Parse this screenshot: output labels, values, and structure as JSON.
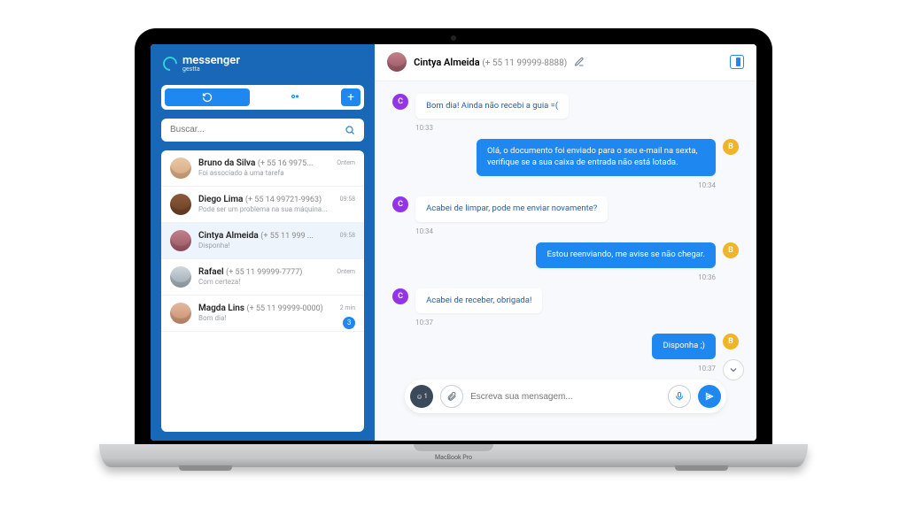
{
  "brand": {
    "name": "messenger",
    "sub": "gestta"
  },
  "search": {
    "placeholder": "Buscar..."
  },
  "segmented": {
    "add_label": "+"
  },
  "conversations": [
    {
      "name": "Bruno da Silva",
      "phone": "(+ 55 16 9975...",
      "preview": "Foi associado à uma tarefa",
      "time": "Ontem"
    },
    {
      "name": "Diego Lima",
      "phone": "(+ 55 14 99721-9963)",
      "preview": "Pode ser um problema na sua máquina...",
      "time": "09:58"
    },
    {
      "name": "Cintya Almeida",
      "phone": "(+ 55 11 999 ...",
      "preview": "Disponha!",
      "time": "09:58"
    },
    {
      "name": "Rafael",
      "phone": "(+ 55 11 99999-7777)",
      "preview": "Com certeza!",
      "time": "Ontem"
    },
    {
      "name": "Magda Lins",
      "phone": "(+ 55 11 99999-0000)",
      "preview": "Bom dia!",
      "time": "2 min",
      "badge": "3"
    }
  ],
  "header": {
    "name": "Cintya Almeida",
    "phone": "(+ 55 11 99999-8888)"
  },
  "messages": [
    {
      "side": "in",
      "who": "C",
      "text": "Bom dia! Ainda não recebi a guia =(",
      "time": "10:33"
    },
    {
      "side": "out",
      "who": "B",
      "text": "Olá, o documento foi enviado para o seu e-mail na sexta, verifique se a sua caixa de entrada não está lotada.",
      "time": "10:34"
    },
    {
      "side": "in",
      "who": "C",
      "text": "Acabei de limpar, pode me enviar novamente?",
      "time": "10:34"
    },
    {
      "side": "out",
      "who": "B",
      "text": "Estou reenviando, me avise se não chegar.",
      "time": "10:36"
    },
    {
      "side": "in",
      "who": "C",
      "text": "Acabei de receber, obrigada!",
      "time": "10:37"
    },
    {
      "side": "out",
      "who": "B",
      "text": "Disponha ;)",
      "time": "10:37"
    }
  ],
  "composer": {
    "placeholder": "Escreva sua mensagem...",
    "emoji_badge": "1"
  },
  "laptop": {
    "model": "MacBook Pro"
  }
}
